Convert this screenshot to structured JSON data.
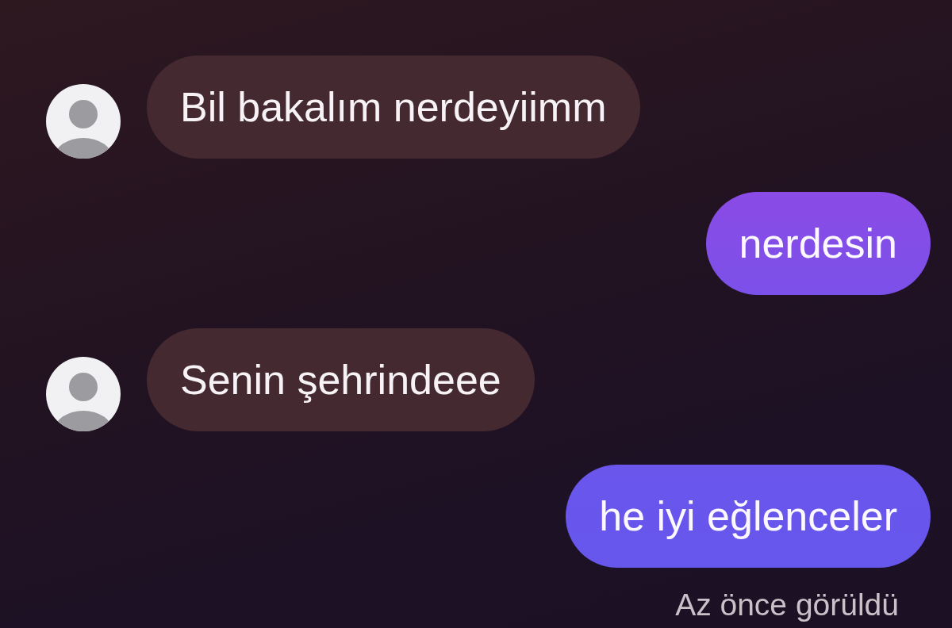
{
  "messages": [
    {
      "kind": "received",
      "text": "Bil bakalım nerdeyiimm"
    },
    {
      "kind": "sent",
      "text": "nerdesin"
    },
    {
      "kind": "received",
      "text": "Senin şehrindeee"
    },
    {
      "kind": "sent",
      "text": "he iyi eğlenceler"
    }
  ],
  "seen_status": "Az önce görüldü"
}
